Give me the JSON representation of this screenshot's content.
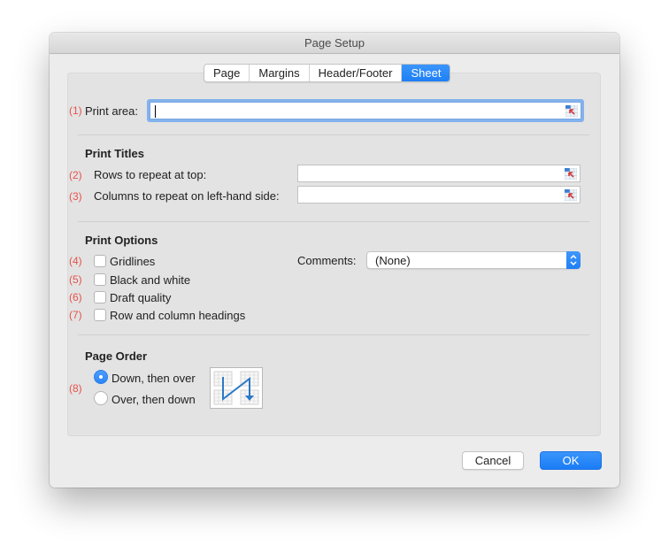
{
  "window": {
    "title": "Page Setup"
  },
  "tabs": [
    {
      "label": "Page",
      "active": false
    },
    {
      "label": "Margins",
      "active": false
    },
    {
      "label": "Header/Footer",
      "active": false
    },
    {
      "label": "Sheet",
      "active": true
    }
  ],
  "print_area": {
    "number": "(1)",
    "label": "Print area:",
    "value": "",
    "icon": "range-selector-icon"
  },
  "print_titles": {
    "title": "Print Titles",
    "rows": {
      "number": "(2)",
      "label": "Rows to repeat at top:",
      "value": "",
      "icon": "range-selector-icon"
    },
    "columns": {
      "number": "(3)",
      "label": "Columns to repeat on left-hand side:",
      "value": "",
      "icon": "range-selector-icon"
    }
  },
  "print_options": {
    "title": "Print Options",
    "items": [
      {
        "number": "(4)",
        "label": "Gridlines",
        "checked": false
      },
      {
        "number": "(5)",
        "label": "Black and white",
        "checked": false
      },
      {
        "number": "(6)",
        "label": "Draft quality",
        "checked": false
      },
      {
        "number": "(7)",
        "label": "Row and column headings",
        "checked": false
      }
    ],
    "comments": {
      "label": "Comments:",
      "value": "(None)"
    }
  },
  "page_order": {
    "title": "Page Order",
    "number": "(8)",
    "options": [
      {
        "label": "Down, then over",
        "selected": true
      },
      {
        "label": "Over, then down",
        "selected": false
      }
    ],
    "preview_icon": "page-order-down-then-over-icon"
  },
  "buttons": {
    "cancel": "Cancel",
    "ok": "OK"
  },
  "colors": {
    "accent": "#2a86f8",
    "annotation": "#e5534b"
  }
}
